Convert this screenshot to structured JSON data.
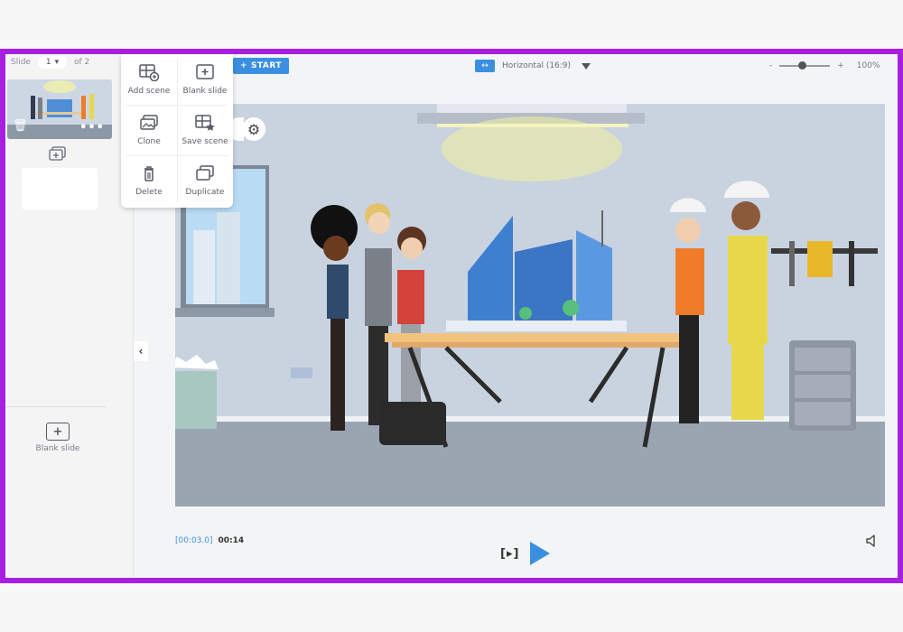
{
  "sidebar": {
    "slide_label": "Slide",
    "slide_number": "1",
    "slide_of": "of 2",
    "blank_slide_label": "Blank slide"
  },
  "popup": {
    "add_scene": "Add scene",
    "blank_slide": "Blank slide",
    "clone": "Clone",
    "save_scene": "Save scene",
    "delete": "Delete",
    "duplicate": "Duplicate"
  },
  "toolbar": {
    "start_label": "START",
    "orientation_label": "Horizontal (16:9)",
    "zoom_minus": "-",
    "zoom_plus": "+",
    "zoom_level": "100%",
    "zoom_fraction": 0.45
  },
  "playback": {
    "current_time": "[00:03.0]",
    "total_time": "00:14"
  },
  "colors": {
    "accent": "#3b8fe0",
    "frame": "#a81fe0"
  }
}
